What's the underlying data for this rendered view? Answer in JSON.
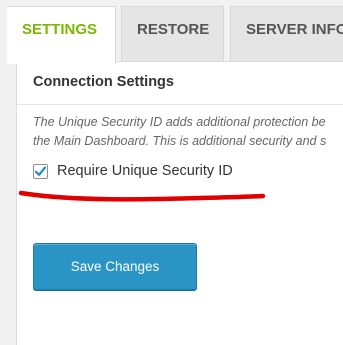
{
  "tabs": [
    {
      "label": "SETTINGS",
      "active": true
    },
    {
      "label": "RESTORE",
      "active": false
    },
    {
      "label": "SERVER INFO",
      "active": false
    }
  ],
  "section": {
    "title": "Connection Settings",
    "description_line1": "The Unique Security ID adds additional protection be",
    "description_line2": "the Main Dashboard. This is additional security and s"
  },
  "require_id": {
    "label": "Require Unique Security ID",
    "checked": true
  },
  "save_button": {
    "label": "Save Changes"
  },
  "colors": {
    "active_tab": "#7ab800",
    "button": "#2a95c5",
    "checkmark": "#1e8cbe",
    "annotation": "#e10000"
  }
}
